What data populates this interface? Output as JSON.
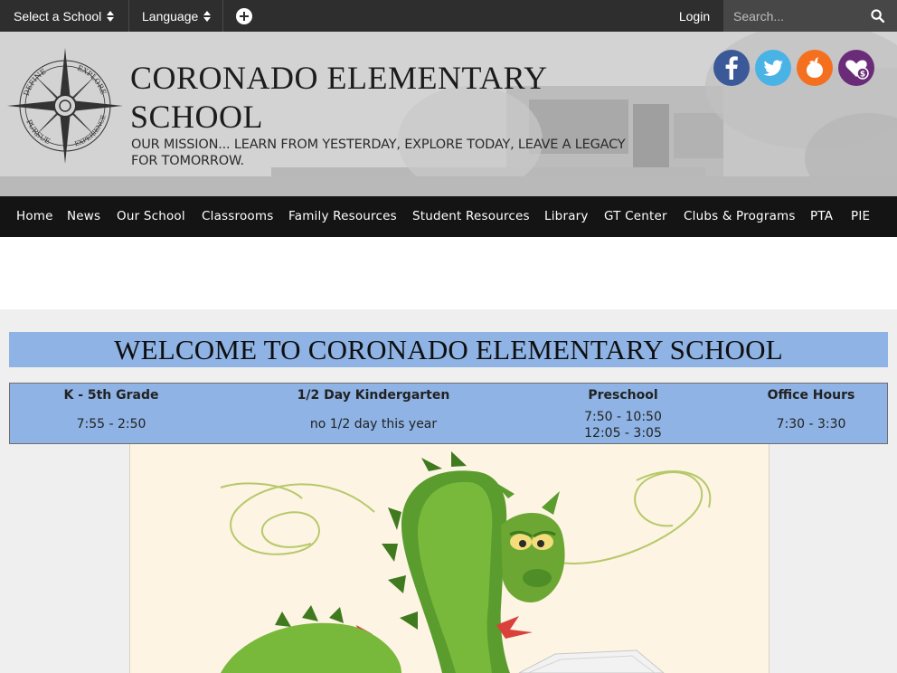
{
  "topbar": {
    "school_select": "Select a School",
    "language": "Language",
    "login": "Login",
    "search_placeholder": "Search...",
    "icons": [
      "sort-icon",
      "plus-circle-icon",
      "search-icon"
    ]
  },
  "header": {
    "title": "CORONADO ELEMENTARY SCHOOL",
    "mission": "OUR MISSION... LEARN FROM YESTERDAY, EXPLORE TODAY, LEAVE A LEGACY FOR TOMORROW.",
    "logo_words": [
      "DEFINE",
      "EXPLORE",
      "EXPERIENCE",
      "PURSUE"
    ],
    "social": [
      {
        "name": "facebook-icon",
        "color": "#3b5998"
      },
      {
        "name": "twitter-icon",
        "color": "#4ab3e6"
      },
      {
        "name": "peachjar-icon",
        "color": "#f4701f"
      },
      {
        "name": "donate-icon",
        "color": "#6a2c78"
      }
    ]
  },
  "nav": {
    "items": [
      "Home",
      "News",
      "Our School",
      "Classrooms",
      "Family Resources",
      "Student Resources",
      "Library",
      "GT Center",
      "Clubs & Programs",
      "PTA",
      "PIE"
    ]
  },
  "welcome": {
    "heading": "WELCOME TO CORONADO ELEMENTARY SCHOOL",
    "bg_color": "#8eb3e4"
  },
  "hours": [
    {
      "header": "K - 5th Grade",
      "value": "7:55 - 2:50"
    },
    {
      "header": "1/2 Day Kindergarten",
      "value": "no 1/2 day this year"
    },
    {
      "header": "Preschool",
      "value_line1": "7:50 - 10:50",
      "value_line2": "12:05 - 3:05"
    },
    {
      "header": "Office Hours",
      "value": "7:30 - 3:30"
    }
  ],
  "illustration": {
    "subject": "green-dragon-reading-book"
  }
}
